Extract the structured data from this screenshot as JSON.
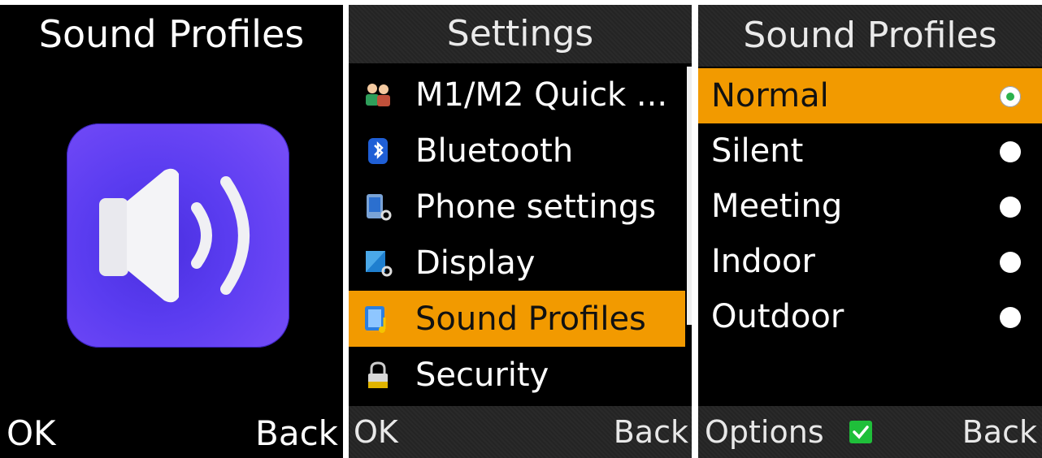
{
  "screen1": {
    "title": "Sound Profiles",
    "icon": "speaker-icon",
    "softkey_left": "OK",
    "softkey_right": "Back"
  },
  "screen2": {
    "title": "Settings",
    "items": [
      {
        "label": "M1/M2 Quick ...",
        "icon": "contacts-icon"
      },
      {
        "label": "Bluetooth",
        "icon": "bluetooth-icon"
      },
      {
        "label": "Phone settings",
        "icon": "phone-settings-icon"
      },
      {
        "label": "Display",
        "icon": "display-icon"
      },
      {
        "label": "Sound Profiles",
        "icon": "sound-profiles-icon",
        "selected": true
      },
      {
        "label": "Security",
        "icon": "lock-icon"
      }
    ],
    "softkey_left": "OK",
    "softkey_right": "Back"
  },
  "screen3": {
    "title": "Sound Profiles",
    "profiles": [
      {
        "label": "Normal",
        "selected": true
      },
      {
        "label": "Silent",
        "selected": false
      },
      {
        "label": "Meeting",
        "selected": false
      },
      {
        "label": "Indoor",
        "selected": false
      },
      {
        "label": "Outdoor",
        "selected": false
      }
    ],
    "softkey_left": "Options",
    "softkey_right": "Back"
  },
  "colors": {
    "highlight": "#f29a00",
    "icon_purple": "#5a3cf0",
    "radio_dot": "#2bb24c",
    "checkbox": "#1fbf3a"
  }
}
